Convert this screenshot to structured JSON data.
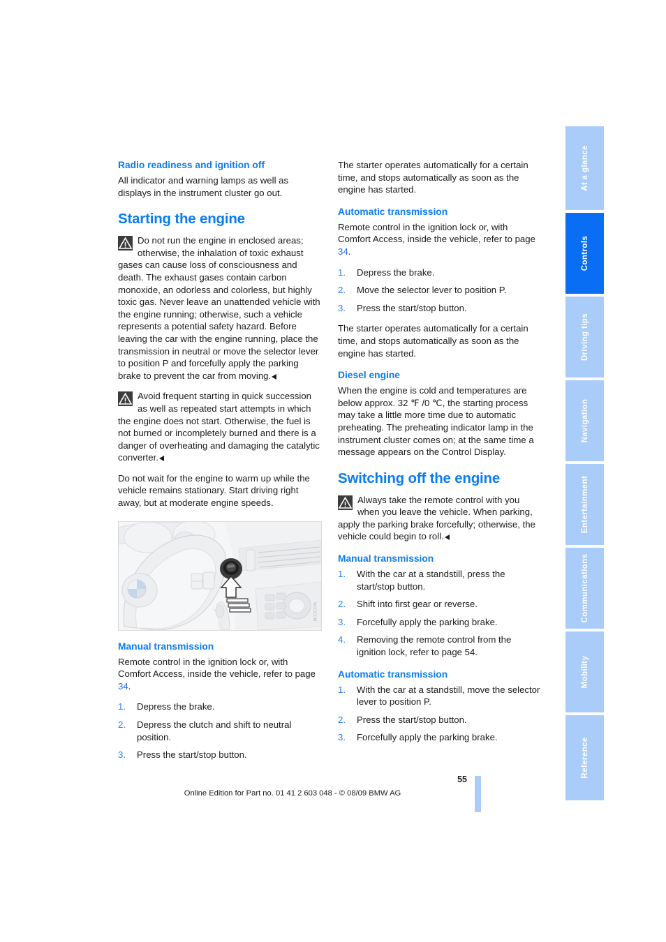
{
  "document": {
    "page_number": "55",
    "footer": "Online Edition for Part no. 01 41 2 603 048 - © 08/09 BMW AG",
    "figure_code": "WICKCM",
    "colors": {
      "heading_blue": "#0a7cf2",
      "tab_blue": "#aaccf8",
      "tab_active_blue": "#0a6ef5",
      "link_blue": "#2a6af0"
    }
  },
  "tabs": [
    {
      "label": "At a glance",
      "active": false
    },
    {
      "label": "Controls",
      "active": true
    },
    {
      "label": "Driving tips",
      "active": false
    },
    {
      "label": "Navigation",
      "active": false
    },
    {
      "label": "Entertainment",
      "active": false
    },
    {
      "label": "Communications",
      "active": false
    },
    {
      "label": "Mobility",
      "active": false
    },
    {
      "label": "Reference",
      "active": false
    }
  ],
  "left_column": {
    "radio_heading": "Radio readiness and ignition off",
    "radio_body": "All indicator and warning lamps as well as displays in the instrument cluster go out.",
    "starting_title": "Starting the engine",
    "warning_1": "Do not run the engine in enclosed areas; otherwise, the inhalation of toxic exhaust gases can cause loss of consciousness and death. The exhaust gases contain carbon monoxide, an odorless and colorless, but highly toxic gas. Never leave an unattended vehicle with the engine running; otherwise, such a vehicle represents a potential safety hazard. Before leaving the car with the engine running, place the transmission in neutral or move the selector lever to position P and forcefully apply the parking brake to prevent the car from moving.",
    "warning_2": "Avoid frequent starting in quick succession as well as repeated start attempts in which the engine does not start. Otherwise, the fuel is not burned or incompletely burned and there is a danger of overheating and damaging the catalytic converter.",
    "warmup_note": "Do not wait for the engine to warm up while the vehicle remains stationary. Start driving right away, but at moderate engine speeds.",
    "manual_heading": "Manual transmission",
    "manual_intro_a": "Remote control in the ignition lock or, with Comfort Access, inside the vehicle, refer to page ",
    "manual_intro_page": "34",
    "manual_intro_b": ".",
    "manual_steps": [
      {
        "num": "1.",
        "text": "Depress the brake."
      },
      {
        "num": "2.",
        "text": "Depress the clutch and shift to neutral position."
      },
      {
        "num": "3.",
        "text": "Press the start/stop button."
      }
    ]
  },
  "right_column": {
    "starter_note_1": "The starter operates automatically for a certain time, and stops automatically as soon as the engine has started.",
    "auto_heading": "Automatic transmission",
    "auto_intro_a": "Remote control in the ignition lock or, with Comfort Access, inside the vehicle, refer to page ",
    "auto_intro_page": "34",
    "auto_intro_b": ".",
    "auto_steps": [
      {
        "num": "1.",
        "text": "Depress the brake."
      },
      {
        "num": "2.",
        "text": "Move the selector lever to position P."
      },
      {
        "num": "3.",
        "text": "Press the start/stop button."
      }
    ],
    "starter_note_2": "The starter operates automatically for a certain time, and stops automatically as soon as the engine has started.",
    "diesel_heading": "Diesel engine",
    "diesel_body": "When the engine is cold and temperatures are below approx. 32 ℉ /0 ℃, the starting process may take a little more time due to automatic preheating. The preheating indicator lamp in the instrument cluster comes on; at the same time a message appears on the Control Display.",
    "switching_title": "Switching off the engine",
    "switching_warning": "Always take the remote control with you when you leave the vehicle.",
    "switching_warning_cont": "When parking, apply the parking brake forcefully; otherwise, the vehicle could begin to roll.",
    "off_manual_heading": "Manual transmission",
    "off_manual_steps": [
      {
        "num": "1.",
        "text": "With the car at a standstill, press the start/stop button."
      },
      {
        "num": "2.",
        "text": "Shift into first gear or reverse."
      },
      {
        "num": "3.",
        "text": "Forcefully apply the parking brake."
      },
      {
        "num": "4.",
        "text": "Removing the remote control from the ignition lock, refer to page 54."
      }
    ],
    "off_auto_heading": "Automatic transmission",
    "off_auto_steps": [
      {
        "num": "1.",
        "text": "With the car at a standstill, move the selector lever to position P."
      },
      {
        "num": "2.",
        "text": "Press the start/stop button."
      },
      {
        "num": "3.",
        "text": "Forcefully apply the parking brake."
      }
    ]
  }
}
